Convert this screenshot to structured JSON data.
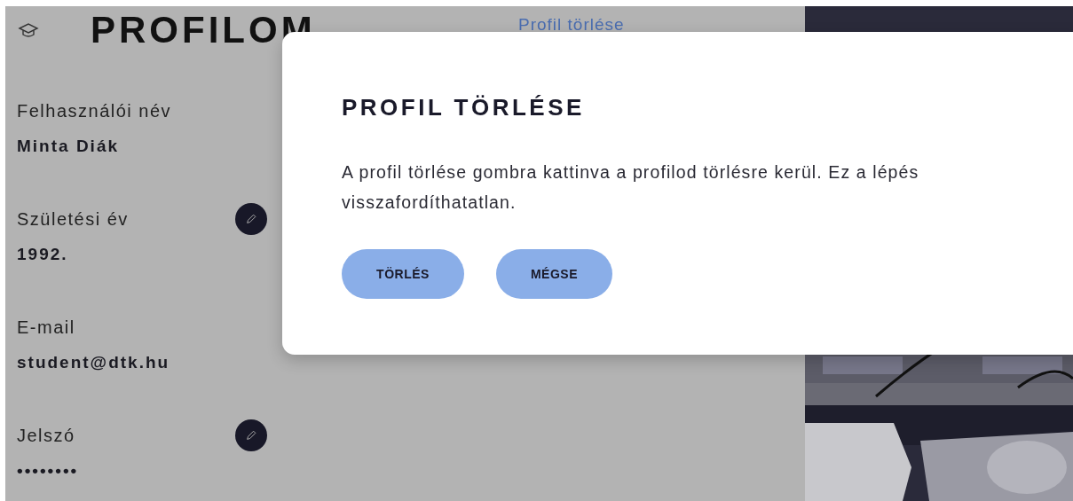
{
  "page": {
    "title": "PROFILOM",
    "delete_link": "Profil törlése"
  },
  "fields": [
    {
      "label": "Felhasználói név",
      "value": "Minta Diák",
      "editable": false
    },
    {
      "label": "Születési év",
      "value": "1992.",
      "editable": true
    },
    {
      "label": "E-mail",
      "value": "student@dtk.hu",
      "editable": false
    },
    {
      "label": "Jelszó",
      "value": "••••••••",
      "editable": true
    }
  ],
  "dialog": {
    "title": "PROFIL TÖRLÉSE",
    "message": "A profil törlése gombra kattinva a profilod törlésre kerül. Ez a lépés visszafordíthatatlan.",
    "buttons": [
      "TÖRLÉS",
      "MÉGSE"
    ]
  }
}
